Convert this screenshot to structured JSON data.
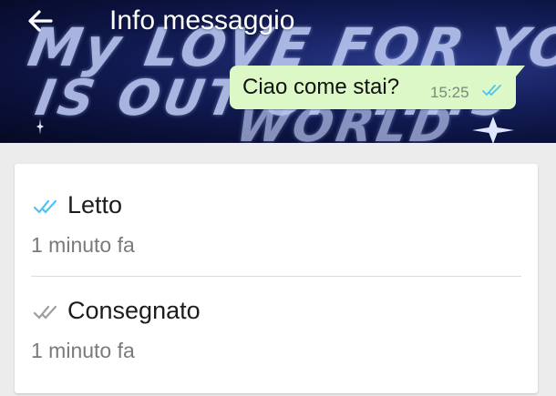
{
  "header": {
    "title": "Info messaggio",
    "back_icon": "arrow-left-icon",
    "wallpaper_text": [
      "My LOVE FOR YOU",
      "IS OUT OF THIS",
      "WORLD"
    ]
  },
  "message": {
    "text": "Ciao come stai?",
    "time": "15:25",
    "status_icon": "double-check-icon",
    "tick_color": "#4fc3f7"
  },
  "receipts": {
    "read": {
      "label": "Letto",
      "time": "1 minuto fa",
      "icon": "double-check-icon",
      "color": "#4fc3f7"
    },
    "delivered": {
      "label": "Consegnato",
      "time": "1 minuto fa",
      "icon": "double-check-icon",
      "color": "#9e9e9e"
    }
  },
  "colors": {
    "bubble": "#dcf8c6",
    "background": "#ececec"
  }
}
